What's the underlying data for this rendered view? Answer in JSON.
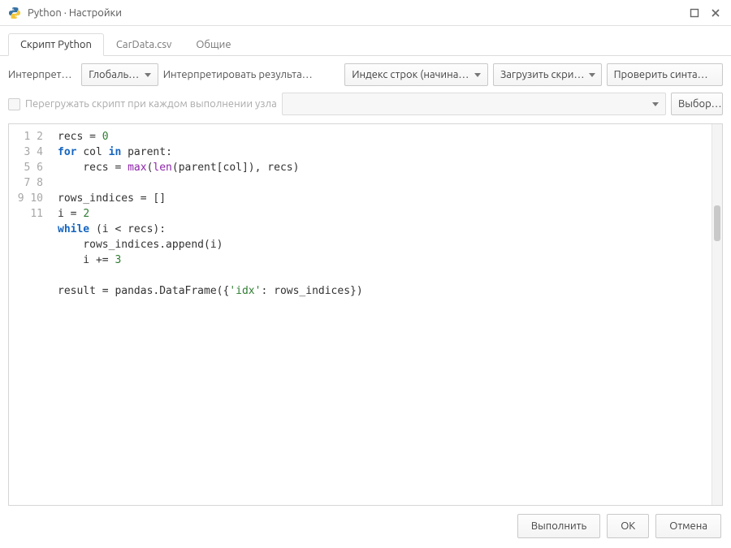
{
  "window": {
    "title": "Python · Настройки"
  },
  "tabs": [
    {
      "label": "Скрипт Python",
      "active": true
    },
    {
      "label": "CarData.csv",
      "active": false
    },
    {
      "label": "Общие",
      "active": false
    }
  ],
  "toolbar": {
    "interpreter_label": "Интерпрета…",
    "interpreter_value": "Глобаль…",
    "interpret_results_label": "Интерпретировать результа…",
    "interpret_results_value": "Индекс строк (начина…",
    "load_script_label": "Загрузить скри…",
    "check_syntax_label": "Проверить синта…",
    "reload_checkbox_label": "Перегружать скрипт при каждом выполнении узла",
    "select_button_label": "Выбор…"
  },
  "editor": {
    "line_count": 11,
    "code_tokens": [
      [
        [
          "recs = ",
          "p"
        ],
        [
          "0",
          "num"
        ]
      ],
      [
        [
          "for ",
          "kw"
        ],
        [
          "col ",
          "p"
        ],
        [
          "in ",
          "kw"
        ],
        [
          "parent:",
          "p"
        ]
      ],
      [
        [
          "    recs = ",
          "p"
        ],
        [
          "max",
          "fn"
        ],
        [
          "(",
          "p"
        ],
        [
          "len",
          "fn"
        ],
        [
          "(parent[col]), recs)",
          "p"
        ]
      ],
      [],
      [
        [
          "rows_indices = []",
          "p"
        ]
      ],
      [
        [
          "i = ",
          "p"
        ],
        [
          "2",
          "num"
        ]
      ],
      [
        [
          "while ",
          "kw"
        ],
        [
          "(i < recs):",
          "p"
        ]
      ],
      [
        [
          "    rows_indices.append(i)",
          "p"
        ]
      ],
      [
        [
          "    i += ",
          "p"
        ],
        [
          "3",
          "num"
        ]
      ],
      [],
      [
        [
          "result = pandas.DataFrame({",
          "p"
        ],
        [
          "'idx'",
          "str"
        ],
        [
          ": rows_indices})",
          "p"
        ]
      ]
    ]
  },
  "footer": {
    "execute": "Выполнить",
    "ok": "OK",
    "cancel": "Отмена"
  }
}
